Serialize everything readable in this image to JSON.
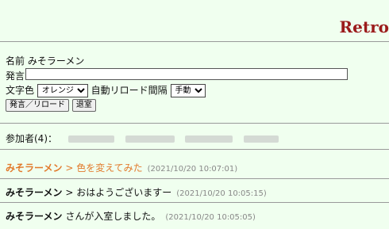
{
  "site_title": "Retro",
  "form": {
    "name_label": "名前",
    "name_value": "みそラーメン",
    "message_label": "発言",
    "message_value": "",
    "color_label": "文字色",
    "color_selected": "オレンジ",
    "reload_label": "自動リロード間隔",
    "reload_selected": "手動",
    "post_button": "発言／リロード",
    "leave_button": "退室"
  },
  "participants": {
    "label": "参加者(4)："
  },
  "messages": [
    {
      "name": "みそラーメン",
      "separator": " > ",
      "text": "色を変えてみた",
      "time": "(2021/10/20 10:07:01)",
      "color": "#e27a2c"
    },
    {
      "name": "みそラーメン",
      "separator": " > ",
      "text": "おはようございますー",
      "time": "(2021/10/20 10:05:15)",
      "color": "#111111"
    },
    {
      "name": "みそラーメン",
      "separator": " ",
      "text": "さんが入室しました。",
      "time": "(2021/10/20 10:05:05)",
      "color": "#111111"
    }
  ],
  "colors": {
    "background": "#f0ffef",
    "title": "#9b1b1b",
    "orange": "#e27a2c"
  }
}
